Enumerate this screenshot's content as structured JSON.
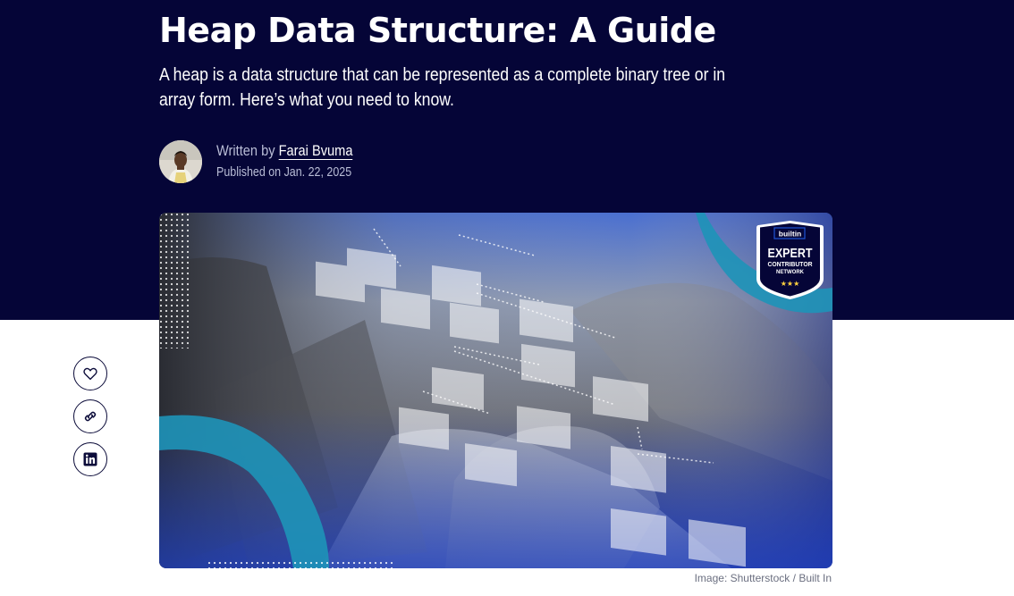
{
  "article": {
    "title": "Heap Data Structure: A Guide",
    "subtitle": "A heap is a data structure that can be represented as a complete binary tree or in array form. Here’s what you need to know.",
    "byline_prefix": "Written by",
    "author_name": "Farai Bvuma",
    "published": "Published on Jan. 22, 2025"
  },
  "hero": {
    "caption": "Image: Shutterstock / Built In",
    "badge": {
      "brand": "builtin",
      "line1": "EXPERT",
      "line2": "CONTRIBUTOR",
      "line3": "NETWORK",
      "stars": "★★★"
    }
  },
  "share": [
    {
      "name": "like-button",
      "icon": "heart-icon"
    },
    {
      "name": "copy-link-button",
      "icon": "link-icon"
    },
    {
      "name": "linkedin-share-button",
      "icon": "linkedin-icon"
    }
  ],
  "colors": {
    "header_bg": "#050537",
    "accent_blue": "#1f55d6",
    "teal": "#1e93b8"
  }
}
